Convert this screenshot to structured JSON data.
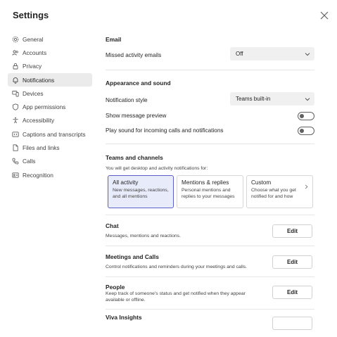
{
  "window": {
    "title": "Settings"
  },
  "sidebar": {
    "items": [
      {
        "label": "General",
        "icon": "gear-icon"
      },
      {
        "label": "Accounts",
        "icon": "accounts-icon"
      },
      {
        "label": "Privacy",
        "icon": "lock-icon"
      },
      {
        "label": "Notifications",
        "icon": "bell-icon",
        "active": true
      },
      {
        "label": "Devices",
        "icon": "devices-icon"
      },
      {
        "label": "App permissions",
        "icon": "shield-icon"
      },
      {
        "label": "Accessibility",
        "icon": "accessibility-icon"
      },
      {
        "label": "Captions and transcripts",
        "icon": "captions-icon"
      },
      {
        "label": "Files and links",
        "icon": "file-icon"
      },
      {
        "label": "Calls",
        "icon": "phone-icon"
      },
      {
        "label": "Recognition",
        "icon": "recognition-icon"
      }
    ]
  },
  "email": {
    "heading": "Email",
    "missed_label": "Missed activity emails",
    "missed_value": "Off"
  },
  "appearance": {
    "heading": "Appearance and sound",
    "style_label": "Notification style",
    "style_value": "Teams built-in",
    "preview_label": "Show message preview",
    "preview_on": false,
    "sound_label": "Play sound for incoming calls and notifications",
    "sound_on": false
  },
  "teams_channels": {
    "heading": "Teams and channels",
    "subtitle": "You will get desktop and activity notifications for:",
    "cards": [
      {
        "title": "All activity",
        "desc": "New messages, reactions, and all mentions",
        "selected": true
      },
      {
        "title": "Mentions & replies",
        "desc": "Personal mentions and replies to your messages",
        "selected": false
      },
      {
        "title": "Custom",
        "desc": "Choose what you get notified for and how",
        "selected": false
      }
    ]
  },
  "chat": {
    "heading": "Chat",
    "desc": "Messages, mentions and reactions.",
    "button": "Edit"
  },
  "meetings": {
    "heading": "Meetings and Calls",
    "desc": "Control notifications and reminders during your meetings and calls.",
    "button": "Edit"
  },
  "people": {
    "heading": "People",
    "desc": "Keep track of someone's status and get notified when they appear available or offline.",
    "button": "Edit"
  },
  "viva": {
    "heading": "Viva Insights"
  },
  "colors": {
    "accent": "#5b5fc7",
    "selected_bg": "#e8ebfa",
    "nav_active_bg": "#ebebeb"
  }
}
